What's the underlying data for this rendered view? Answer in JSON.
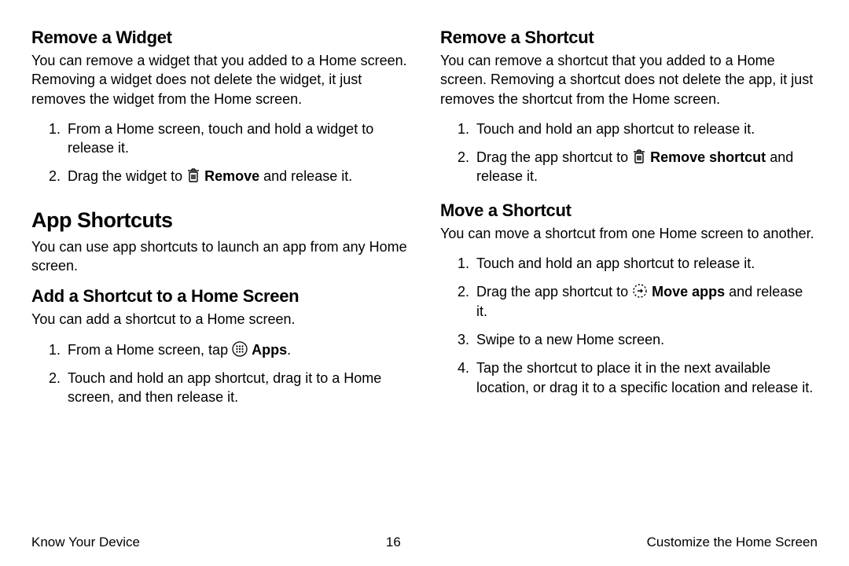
{
  "left": {
    "remove_widget": {
      "heading": "Remove a Widget",
      "intro": "You can remove a widget that you added to a Home screen. Removing a widget does not delete the widget, it just removes the widget from the Home screen.",
      "step1": "From a Home screen, touch and hold a widget to release it.",
      "step2_a": "Drag the widget to ",
      "step2_b": "Remove",
      "step2_c": " and release it."
    },
    "app_shortcuts": {
      "heading": "App Shortcuts",
      "intro": "You can use app shortcuts to launch an app from any Home screen."
    },
    "add_shortcut": {
      "heading": "Add a Shortcut to a Home Screen",
      "intro": "You can add a shortcut to a Home screen.",
      "step1_a": "From a Home screen, tap ",
      "step1_b": "Apps",
      "step1_c": ".",
      "step2": "Touch and hold an app shortcut, drag it to a Home screen, and then release it."
    }
  },
  "right": {
    "remove_shortcut": {
      "heading": "Remove a Shortcut",
      "intro": "You can remove a shortcut that you added to a Home screen. Removing a shortcut does not delete the app, it just removes the shortcut from the Home screen.",
      "step1": "Touch and hold an app shortcut to release it.",
      "step2_a": "Drag the app shortcut to ",
      "step2_b": "Remove shortcut",
      "step2_c": " and release it."
    },
    "move_shortcut": {
      "heading": "Move a Shortcut",
      "intro": "You can move a shortcut from one Home screen to another.",
      "step1": "Touch and hold an app shortcut to release it.",
      "step2_a": "Drag the app shortcut to ",
      "step2_b": "Move apps",
      "step2_c": " and release it.",
      "step3": "Swipe to a new Home screen.",
      "step4": "Tap the shortcut to place it in the next available location, or drag it to a specific location and release it."
    }
  },
  "footer": {
    "left": "Know Your Device",
    "center": "16",
    "right": "Customize the Home Screen"
  }
}
